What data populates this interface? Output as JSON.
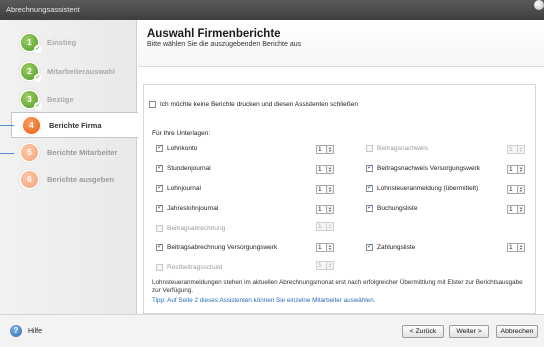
{
  "window": {
    "title": "Abrechnungsassistent"
  },
  "sidebar": {
    "steps": [
      {
        "number": "1",
        "label": "Einstieg",
        "state": "done"
      },
      {
        "number": "2",
        "label": "Mitarbeiterauswahl",
        "state": "done"
      },
      {
        "number": "3",
        "label": "Bezüge",
        "state": "done"
      },
      {
        "number": "4",
        "label": "Berichte Firma",
        "state": "active"
      },
      {
        "number": "5",
        "label": "Berichte Mitarbeiter",
        "state": "pending"
      },
      {
        "number": "6",
        "label": "Berichte ausgeben",
        "state": "pending"
      }
    ]
  },
  "header": {
    "title": "Auswahl Firmenberichte",
    "subtitle": "Bitte wählen Sie die auszugebenden Berichte aus"
  },
  "content": {
    "skip_reports_label": "Ich möchte keine Berichte drucken und diesen Assistenten schließen",
    "section_label": "Für Ihre Unterlagen:",
    "left_reports": [
      {
        "label": "Lohnkonto",
        "checked": true,
        "enabled": true,
        "copies": "1",
        "copies_enabled": true
      },
      {
        "label": "Stundenjournal",
        "checked": true,
        "enabled": true,
        "copies": "1",
        "copies_enabled": true
      },
      {
        "label": "Lohnjournal",
        "checked": true,
        "enabled": true,
        "copies": "1",
        "copies_enabled": true
      },
      {
        "label": "Jahreslohnjournal",
        "checked": true,
        "enabled": true,
        "copies": "1",
        "copies_enabled": true
      },
      {
        "label": "Beitragsabrechnung",
        "checked": false,
        "enabled": false,
        "copies": "1",
        "copies_enabled": false
      },
      {
        "label": "Beitragsabrechnung Versorgungswerk",
        "checked": true,
        "enabled": true,
        "copies": "1",
        "copies_enabled": true
      },
      {
        "label": "Restbeitragsschuld",
        "checked": false,
        "enabled": false,
        "copies": "1",
        "copies_enabled": false
      }
    ],
    "right_reports": [
      {
        "label": "Beitragsnachweis",
        "checked": false,
        "enabled": false,
        "copies": "1",
        "copies_enabled": false
      },
      {
        "label": "Beitragsnachweis Versorgungswerk",
        "checked": true,
        "enabled": true,
        "copies": "1",
        "copies_enabled": true
      },
      {
        "label": "Lohnsteueranmeldung (übermittelt)",
        "checked": true,
        "enabled": true,
        "copies": "1",
        "copies_enabled": true
      },
      {
        "label": "Buchungsliste",
        "checked": true,
        "enabled": true,
        "copies": "1",
        "copies_enabled": true
      },
      {
        "label": "Zahlungsliste",
        "checked": true,
        "enabled": true,
        "copies": "1",
        "copies_enabled": true
      }
    ],
    "note": "Lohnsteueranmeldungen stehen im aktuellen Abrechnungsmonat erst nach erfolgreicher Übermittlung mit Elster zur Berichtsausgabe zur Verfügung.",
    "tip": "Tipp: Auf Seite 2 dieses Assistenten können Sie einzelne Mitarbeiter auswählen."
  },
  "footer": {
    "help_label": "Hilfe",
    "back_label": "< Zurück",
    "next_label": "Weiter >",
    "cancel_label": "Abbrechen"
  },
  "colors": {
    "accent_blue": "#4a8fcf",
    "active_step": "#e35a12",
    "done_step": "#4e9a1e"
  }
}
